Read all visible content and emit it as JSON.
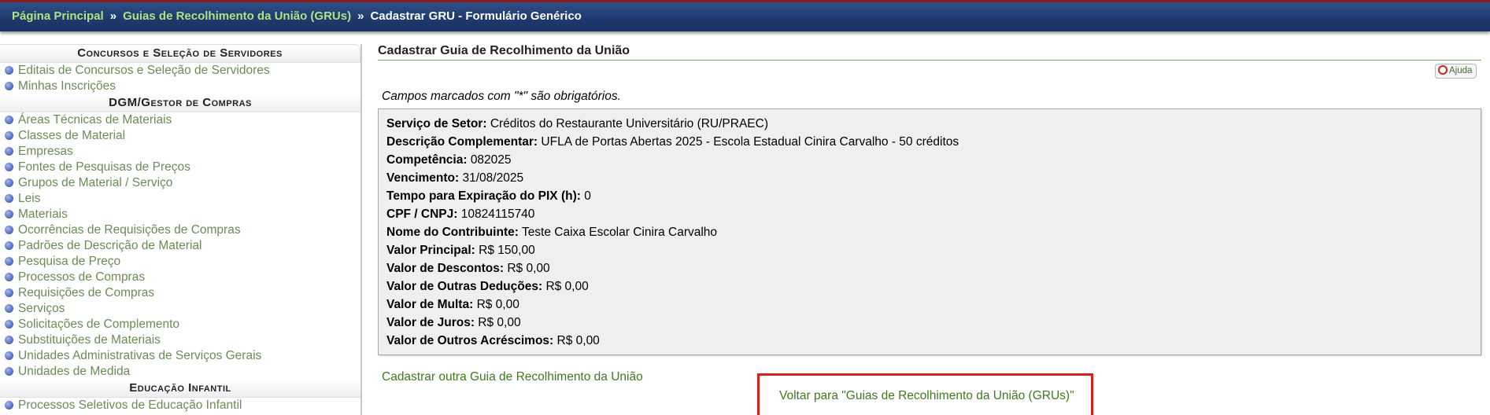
{
  "breadcrumb": {
    "home": "Página Principal",
    "sep1": "»",
    "grus": "Guias de Recolhimento da União (GRUs)",
    "sep2": "»",
    "current": "Cadastrar GRU - Formulário Genérico"
  },
  "sidebar": {
    "sections": [
      {
        "title": "Concursos e Seleção de Servidores",
        "items": [
          "Editais de Concursos e Seleção de Servidores",
          "Minhas Inscrições"
        ]
      },
      {
        "title": "DGM/Gestor de Compras",
        "items": [
          "Áreas Técnicas de Materiais",
          "Classes de Material",
          "Empresas",
          "Fontes de Pesquisas de Preços",
          "Grupos de Material / Serviço",
          "Leis",
          "Materiais",
          "Ocorrências de Requisições de Compras",
          "Padrões de Descrição de Material",
          "Pesquisa de Preço",
          "Processos de Compras",
          "Requisições de Compras",
          "Serviços",
          "Solicitações de Complemento",
          "Substituições de Materiais",
          "Unidades Administrativas de Serviços Gerais",
          "Unidades de Medida"
        ]
      },
      {
        "title": "Educação Infantil",
        "items": [
          "Processos Seletivos de Educação Infantil"
        ]
      }
    ]
  },
  "main": {
    "title": "Cadastrar Guia de Recolhimento da União",
    "help_label": "Ajuda",
    "required_note": "Campos marcados com \"*\" são obrigatórios.",
    "fields": [
      {
        "label": "Serviço de Setor:",
        "value": "Créditos do Restaurante Universitário (RU/PRAEC)"
      },
      {
        "label": "Descrição Complementar:",
        "value": "UFLA de Portas Abertas 2025 - Escola Estadual Cinira Carvalho - 50 créditos"
      },
      {
        "label": "Competência:",
        "value": "082025"
      },
      {
        "label": "Vencimento:",
        "value": "31/08/2025"
      },
      {
        "label": "Tempo para Expiração do PIX (h):",
        "value": "0"
      },
      {
        "label": "CPF / CNPJ:",
        "value": "10824115740"
      },
      {
        "label": "Nome do Contribuinte:",
        "value": "Teste Caixa Escolar Cinira Carvalho"
      },
      {
        "label": "Valor Principal:",
        "value": "R$ 150,00"
      },
      {
        "label": "Valor de Descontos:",
        "value": "R$ 0,00"
      },
      {
        "label": "Valor de Outras Deduções:",
        "value": "R$ 0,00"
      },
      {
        "label": "Valor de Multa:",
        "value": "R$ 0,00"
      },
      {
        "label": "Valor de Juros:",
        "value": "R$ 0,00"
      },
      {
        "label": "Valor de Outros Acréscimos:",
        "value": "R$ 0,00"
      }
    ],
    "another_link": "Cadastrar outra Guia de Recolhimento da União",
    "back_link": "Voltar para \"Guias de Recolhimento da União (GRUs)\""
  },
  "colors": {
    "topbar": "#1f3a6e",
    "breadcrumb_link": "#b6e07f",
    "link_green": "#3e7a1f",
    "sidebar_link": "#6b8c55",
    "highlight_border": "#dd1e1e"
  }
}
